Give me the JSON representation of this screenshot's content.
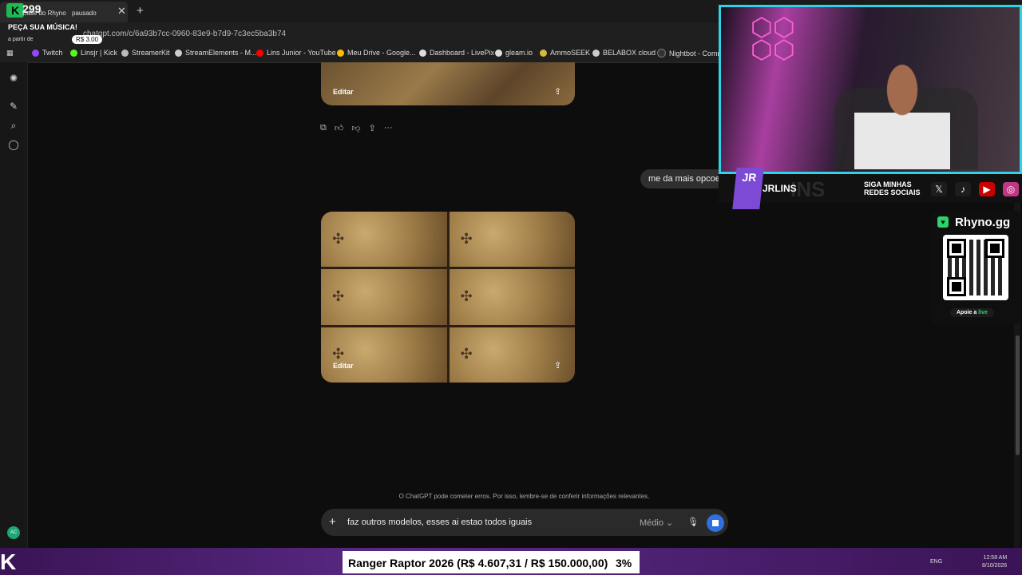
{
  "browser": {
    "tab_title": "Dalle do Rhyno",
    "url": "chatgpt.com/c/6a93b7cc-0960-83e9-b7d9-7c3ec5ba3b74",
    "bookmarks": [
      "Twitch",
      "Linsjr | Kick",
      "StreamerKit",
      "StreamElements - M...",
      "Lins Junior - YouTube",
      "Meu Drive - Google...",
      "Dashboard - LivePix",
      "gleam.io",
      "AmmoSEEK",
      "BELABOX cloud",
      "Nightbot - Comm"
    ]
  },
  "overlay_topleft": {
    "count": "299",
    "pausado": "pausado",
    "peca": "PEÇA SUA MÚSICA!",
    "a_partir": "a partir de",
    "price": "R$ 3.00"
  },
  "chat": {
    "edit_label": "Editar",
    "user_message": "me da mais opcoe",
    "disclaimer": "O ChatGPT pode cometer erros. Por isso, lembre-se de conferir informações relevantes.",
    "composer_text": "faz outros modelos, esses ai estao todos iguais",
    "model_label": "Médio",
    "avatar_initials": "AC"
  },
  "stream": {
    "name": "JRLINS",
    "siga_line1": "SIGA MINHAS",
    "siga_line2": "REDES SOCIAIS",
    "rhyno_title": "Rhyno.gg",
    "apoie": "Apoie a",
    "apoie_live": "live",
    "ticker": "Ranger Raptor 2026 (R$ 4.607,31 / R$ 150.000,00)",
    "ticker_pct": "3%",
    "progress": 0.03,
    "lang": "ENG",
    "time": "12:58 AM",
    "date": "8/10/2026"
  },
  "colors": {
    "accent": "#2f6fe0",
    "cam_border": "#2fd3e6",
    "rhyno_green": "#2bd46a"
  }
}
